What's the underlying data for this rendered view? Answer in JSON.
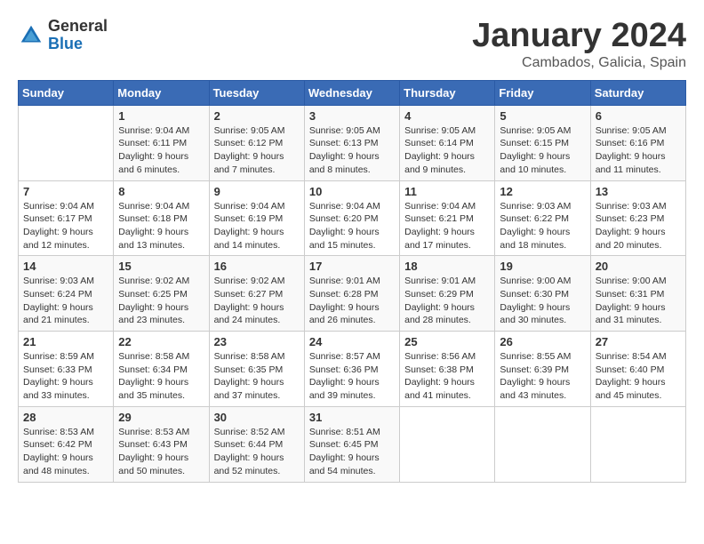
{
  "header": {
    "logo_line1": "General",
    "logo_line2": "Blue",
    "month": "January 2024",
    "location": "Cambados, Galicia, Spain"
  },
  "days_of_week": [
    "Sunday",
    "Monday",
    "Tuesday",
    "Wednesday",
    "Thursday",
    "Friday",
    "Saturday"
  ],
  "weeks": [
    [
      {
        "num": "",
        "info": ""
      },
      {
        "num": "1",
        "info": "Sunrise: 9:04 AM\nSunset: 6:11 PM\nDaylight: 9 hours\nand 6 minutes."
      },
      {
        "num": "2",
        "info": "Sunrise: 9:05 AM\nSunset: 6:12 PM\nDaylight: 9 hours\nand 7 minutes."
      },
      {
        "num": "3",
        "info": "Sunrise: 9:05 AM\nSunset: 6:13 PM\nDaylight: 9 hours\nand 8 minutes."
      },
      {
        "num": "4",
        "info": "Sunrise: 9:05 AM\nSunset: 6:14 PM\nDaylight: 9 hours\nand 9 minutes."
      },
      {
        "num": "5",
        "info": "Sunrise: 9:05 AM\nSunset: 6:15 PM\nDaylight: 9 hours\nand 10 minutes."
      },
      {
        "num": "6",
        "info": "Sunrise: 9:05 AM\nSunset: 6:16 PM\nDaylight: 9 hours\nand 11 minutes."
      }
    ],
    [
      {
        "num": "7",
        "info": "Sunrise: 9:04 AM\nSunset: 6:17 PM\nDaylight: 9 hours\nand 12 minutes."
      },
      {
        "num": "8",
        "info": "Sunrise: 9:04 AM\nSunset: 6:18 PM\nDaylight: 9 hours\nand 13 minutes."
      },
      {
        "num": "9",
        "info": "Sunrise: 9:04 AM\nSunset: 6:19 PM\nDaylight: 9 hours\nand 14 minutes."
      },
      {
        "num": "10",
        "info": "Sunrise: 9:04 AM\nSunset: 6:20 PM\nDaylight: 9 hours\nand 15 minutes."
      },
      {
        "num": "11",
        "info": "Sunrise: 9:04 AM\nSunset: 6:21 PM\nDaylight: 9 hours\nand 17 minutes."
      },
      {
        "num": "12",
        "info": "Sunrise: 9:03 AM\nSunset: 6:22 PM\nDaylight: 9 hours\nand 18 minutes."
      },
      {
        "num": "13",
        "info": "Sunrise: 9:03 AM\nSunset: 6:23 PM\nDaylight: 9 hours\nand 20 minutes."
      }
    ],
    [
      {
        "num": "14",
        "info": "Sunrise: 9:03 AM\nSunset: 6:24 PM\nDaylight: 9 hours\nand 21 minutes."
      },
      {
        "num": "15",
        "info": "Sunrise: 9:02 AM\nSunset: 6:25 PM\nDaylight: 9 hours\nand 23 minutes."
      },
      {
        "num": "16",
        "info": "Sunrise: 9:02 AM\nSunset: 6:27 PM\nDaylight: 9 hours\nand 24 minutes."
      },
      {
        "num": "17",
        "info": "Sunrise: 9:01 AM\nSunset: 6:28 PM\nDaylight: 9 hours\nand 26 minutes."
      },
      {
        "num": "18",
        "info": "Sunrise: 9:01 AM\nSunset: 6:29 PM\nDaylight: 9 hours\nand 28 minutes."
      },
      {
        "num": "19",
        "info": "Sunrise: 9:00 AM\nSunset: 6:30 PM\nDaylight: 9 hours\nand 30 minutes."
      },
      {
        "num": "20",
        "info": "Sunrise: 9:00 AM\nSunset: 6:31 PM\nDaylight: 9 hours\nand 31 minutes."
      }
    ],
    [
      {
        "num": "21",
        "info": "Sunrise: 8:59 AM\nSunset: 6:33 PM\nDaylight: 9 hours\nand 33 minutes."
      },
      {
        "num": "22",
        "info": "Sunrise: 8:58 AM\nSunset: 6:34 PM\nDaylight: 9 hours\nand 35 minutes."
      },
      {
        "num": "23",
        "info": "Sunrise: 8:58 AM\nSunset: 6:35 PM\nDaylight: 9 hours\nand 37 minutes."
      },
      {
        "num": "24",
        "info": "Sunrise: 8:57 AM\nSunset: 6:36 PM\nDaylight: 9 hours\nand 39 minutes."
      },
      {
        "num": "25",
        "info": "Sunrise: 8:56 AM\nSunset: 6:38 PM\nDaylight: 9 hours\nand 41 minutes."
      },
      {
        "num": "26",
        "info": "Sunrise: 8:55 AM\nSunset: 6:39 PM\nDaylight: 9 hours\nand 43 minutes."
      },
      {
        "num": "27",
        "info": "Sunrise: 8:54 AM\nSunset: 6:40 PM\nDaylight: 9 hours\nand 45 minutes."
      }
    ],
    [
      {
        "num": "28",
        "info": "Sunrise: 8:53 AM\nSunset: 6:42 PM\nDaylight: 9 hours\nand 48 minutes."
      },
      {
        "num": "29",
        "info": "Sunrise: 8:53 AM\nSunset: 6:43 PM\nDaylight: 9 hours\nand 50 minutes."
      },
      {
        "num": "30",
        "info": "Sunrise: 8:52 AM\nSunset: 6:44 PM\nDaylight: 9 hours\nand 52 minutes."
      },
      {
        "num": "31",
        "info": "Sunrise: 8:51 AM\nSunset: 6:45 PM\nDaylight: 9 hours\nand 54 minutes."
      },
      {
        "num": "",
        "info": ""
      },
      {
        "num": "",
        "info": ""
      },
      {
        "num": "",
        "info": ""
      }
    ]
  ]
}
